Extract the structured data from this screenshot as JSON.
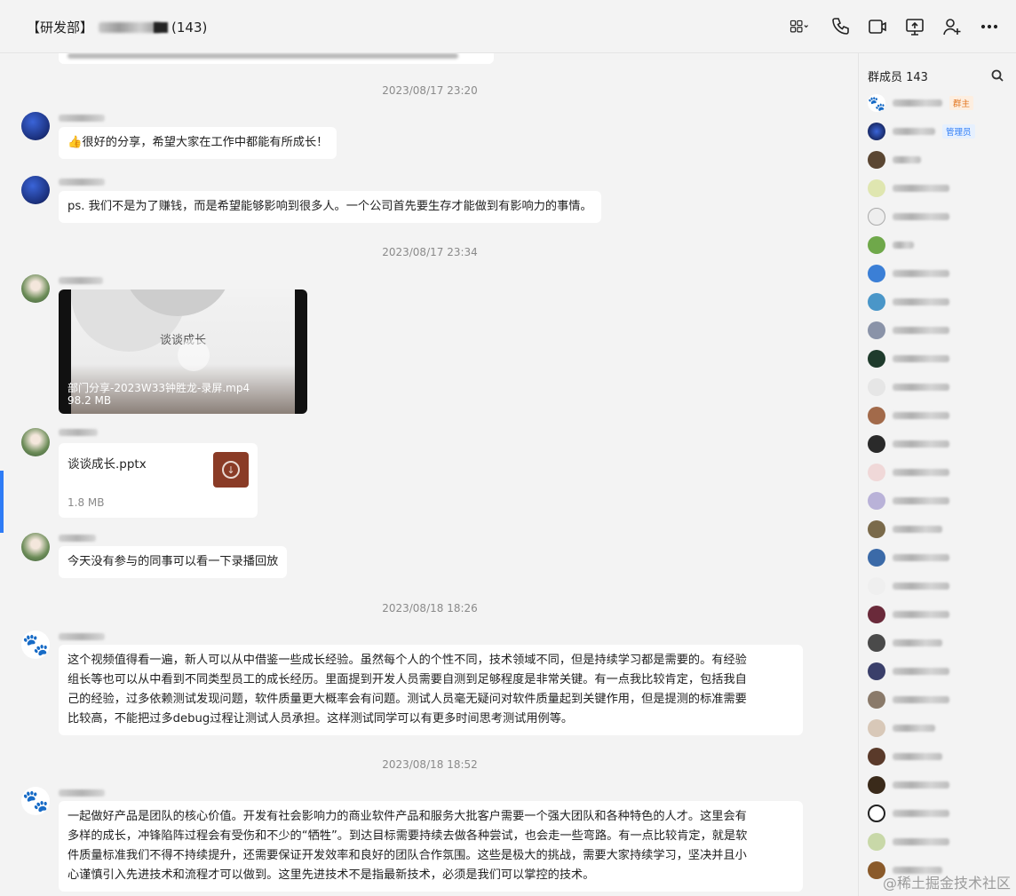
{
  "header": {
    "title_prefix": "【研发部】",
    "title_count": "(143)"
  },
  "toolbar": {
    "icons": [
      "apps-icon",
      "phone-icon",
      "video-call-icon",
      "screen-share-icon",
      "add-member-icon",
      "more-icon"
    ]
  },
  "chat": {
    "partial_bubble_text": "",
    "timestamps": [
      "2023/08/17 23:20",
      "2023/08/17 23:34",
      "2023/08/18 18:26",
      "2023/08/18 18:52"
    ],
    "messages": [
      {
        "text": "👍很好的分享，希望大家在工作中都能有所成长！"
      },
      {
        "text": "ps. 我们不是为了赚钱，而是希望能够影响到很多人。一个公司首先要生存才能做到有影响力的事情。"
      },
      {
        "video": {
          "cover_title": "谈谈成长",
          "file_name": "部门分享-2023W33钟胜龙-录屏.mp4",
          "size": "98.2 MB"
        }
      },
      {
        "file": {
          "name": "谈谈成长.pptx",
          "size": "1.8 MB"
        }
      },
      {
        "text": "今天没有参与的同事可以看一下录播回放"
      },
      {
        "lines": [
          "这个视频值得看一遍，新人可以从中借鉴一些成长经验。虽然每个人的个性不同，技术领域不同，但是持续学习都是需要的。有经验",
          "组长等也可以从中看到不同类型员工的成长经历。里面提到开发人员需要自测到足够程度是非常关键。有一点我比较肯定，包括我自",
          "己的经验，过多依赖测试发现问题，软件质量更大概率会有问题。测试人员毫无疑问对软件质量起到关键作用，但是提测的标准需要",
          "比较高，不能把过多debug过程让测试人员承担。这样测试同学可以有更多时间思考测试用例等。"
        ]
      },
      {
        "lines": [
          "一起做好产品是团队的核心价值。开发有社会影响力的商业软件产品和服务大批客户需要一个强大团队和各种特色的人才。这里会有",
          "多样的成长，冲锋陷阵过程会有受伤和不少的“牺牲”。到达目标需要持续去做各种尝试，也会走一些弯路。有一点比较肯定，就是软",
          "件质量标准我们不得不持续提升，还需要保证开发效率和良好的团队合作氛围。这些是极大的挑战，需要大家持续学习，坚决并且小",
          "心谨慎引入先进技术和流程才可以做到。这里先进技术不是指最新技术，必须是我们可以掌控的技术。"
        ]
      }
    ]
  },
  "members": {
    "title": "群成员 143",
    "owner_badge": "群主",
    "admin_badge": "管理员"
  },
  "watermark": "@稀土掘金技术社区"
}
